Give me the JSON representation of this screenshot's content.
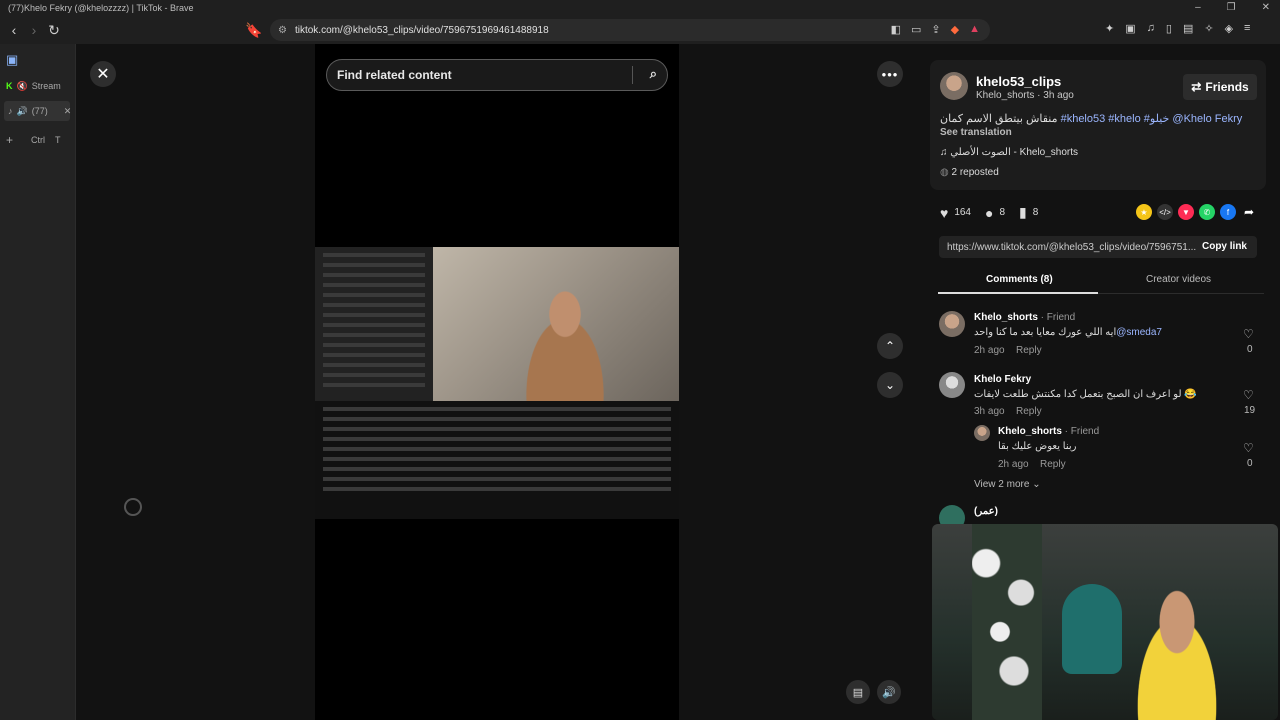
{
  "window": {
    "title": "(77)Khelo Fekry (@khelozzzz) | TikTok - Brave"
  },
  "browser": {
    "url": "tiktok.com/@khelo53_clips/video/7596751969461488918"
  },
  "sidebar": {
    "items": [
      {
        "label": "Stream"
      },
      {
        "label": "(77)"
      }
    ],
    "new_tab_shortcut": [
      "Ctrl",
      "T"
    ]
  },
  "player": {
    "search_placeholder": "Find related content"
  },
  "post": {
    "username": "khelo53_clips",
    "subtitle": "Khelo_shorts · 3h ago",
    "friends_label": "Friends",
    "description_text": "منقاش بيتطق الاسم كمان",
    "hashtags": [
      "#khelo53",
      "#khelo",
      "#خيلو",
      "@Khelo Fekry"
    ],
    "see_translation": "See translation",
    "music": "الصوت الأصلي - Khelo_shorts",
    "reposted": "2 reposted",
    "likes": "164",
    "comments": "8",
    "saves": "8",
    "link": "https://www.tiktok.com/@khelo53_clips/video/7596751...",
    "copy_link": "Copy link"
  },
  "tabs": {
    "comments": "Comments (8)",
    "creator_videos": "Creator videos"
  },
  "comments": [
    {
      "name": "Khelo_shorts",
      "tag": " · Friend",
      "text": "ايه اللي عورك معايا بعد ما كنا واحد",
      "mention": "@smeda7",
      "time": "2h ago",
      "reply": "Reply",
      "likes": "0"
    },
    {
      "name": "Khelo Fekry",
      "tag": "",
      "text": "لو اعرف ان الصبح بتعمل كدا مكنتش طلعت لايفات 😂",
      "time": "3h ago",
      "reply": "Reply",
      "likes": "19"
    },
    {
      "name": "Khelo_shorts",
      "tag": " · Friend",
      "text": "ربنا يعوض عليك بقا",
      "time": "2h ago",
      "reply": "Reply",
      "likes": "0"
    }
  ],
  "view_more": "View 2 more",
  "partial_comment": {
    "name": "(عمر)"
  },
  "colors": {
    "accent_link": "#9bb6ff",
    "panel_bg": "#121212",
    "card_bg": "#1c1c1c"
  }
}
